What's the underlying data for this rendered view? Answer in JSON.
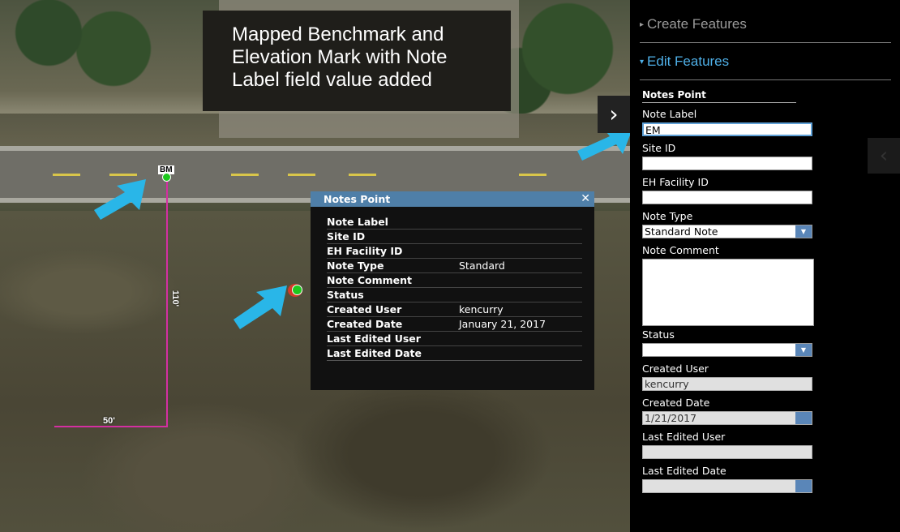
{
  "banner": {
    "lines": [
      "Mapped Benchmark and",
      "Elevation Mark with Note",
      "Label field value added"
    ]
  },
  "map": {
    "bm_label": "BM",
    "dim_vertical": "110'",
    "dim_horizontal": "50'",
    "collapse_icon": "›"
  },
  "popup": {
    "title": "Notes Point",
    "close": "✕",
    "rows": [
      {
        "key": "Note Label",
        "value": ""
      },
      {
        "key": "Site ID",
        "value": ""
      },
      {
        "key": "EH Facility ID",
        "value": ""
      },
      {
        "key": "Note Type",
        "value": "Standard"
      },
      {
        "key": "Note Comment",
        "value": ""
      },
      {
        "key": "Status",
        "value": ""
      },
      {
        "key": "Created User",
        "value": "kencurry"
      },
      {
        "key": "Created Date",
        "value": "January 21, 2017"
      },
      {
        "key": "Last Edited User",
        "value": ""
      },
      {
        "key": "Last Edited Date",
        "value": ""
      }
    ]
  },
  "panel": {
    "create_features": "Create Features",
    "edit_features": "Edit Features",
    "form_title": "Notes Point",
    "fields": {
      "note_label": {
        "label": "Note Label",
        "value": "EM"
      },
      "site_id": {
        "label": "Site ID",
        "value": ""
      },
      "eh_facility_id": {
        "label": "EH Facility ID",
        "value": ""
      },
      "note_type": {
        "label": "Note Type",
        "value": "Standard Note"
      },
      "note_comment": {
        "label": "Note Comment",
        "value": ""
      },
      "status": {
        "label": "Status",
        "value": ""
      },
      "created_user": {
        "label": "Created User",
        "value": "kencurry"
      },
      "created_date": {
        "label": "Created Date",
        "value": "1/21/2017"
      },
      "last_edited_user": {
        "label": "Last Edited User",
        "value": ""
      },
      "last_edited_date": {
        "label": "Last Edited Date",
        "value": ""
      }
    },
    "side_tab_icon": "‹"
  },
  "colors": {
    "accent": "#4fb0e8",
    "popup_header": "#4f7fa8",
    "dimension_line": "#d42fa2",
    "point": "#1ec81e",
    "arrow": "#29b6e8"
  }
}
